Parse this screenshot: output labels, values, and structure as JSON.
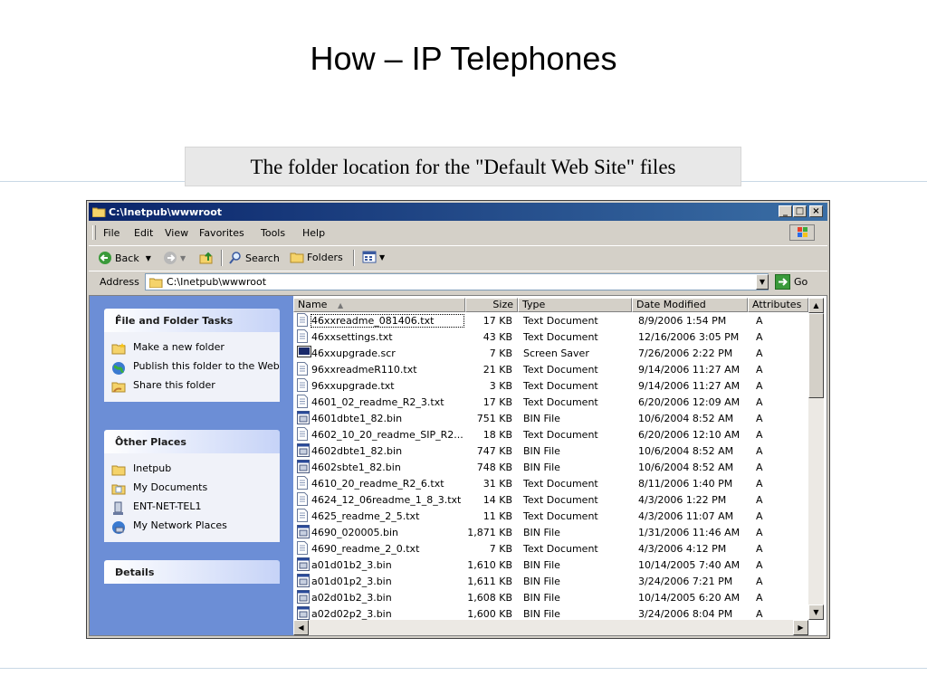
{
  "slide": {
    "title": "How – IP Telephones",
    "caption": "The folder location for the \"Default Web Site\" files"
  },
  "window": {
    "title": "C:\\Inetpub\\wwwroot",
    "menu": [
      "File",
      "Edit",
      "View",
      "Favorites",
      "Tools",
      "Help"
    ],
    "toolbar": {
      "back": "Back",
      "search": "Search",
      "folders": "Folders"
    },
    "address": {
      "label": "Address",
      "value": "C:\\Inetpub\\wwwroot",
      "go": "Go"
    }
  },
  "taskpane": {
    "file_tasks": {
      "title": "File and Folder Tasks",
      "items": [
        "Make a new folder",
        "Publish this folder to the Web",
        "Share this folder"
      ]
    },
    "other_places": {
      "title": "Other Places",
      "items": [
        "Inetpub",
        "My Documents",
        "ENT-NET-TEL1",
        "My Network Places"
      ]
    },
    "details": {
      "title": "Details"
    }
  },
  "columns": [
    "Name",
    "Size",
    "Type",
    "Date Modified",
    "Attributes"
  ],
  "files": [
    {
      "name": "46xxreadme_081406.txt",
      "size": "17 KB",
      "type": "Text Document",
      "date": "8/9/2006 1:54 PM",
      "attr": "A",
      "icon": "text-file-icon"
    },
    {
      "name": "46xxsettings.txt",
      "size": "43 KB",
      "type": "Text Document",
      "date": "12/16/2006 3:05 PM",
      "attr": "A",
      "icon": "text-file-icon"
    },
    {
      "name": "46xxupgrade.scr",
      "size": "7 KB",
      "type": "Screen Saver",
      "date": "7/26/2006 2:22 PM",
      "attr": "A",
      "icon": "screensaver-icon"
    },
    {
      "name": "96xxreadmeR110.txt",
      "size": "21 KB",
      "type": "Text Document",
      "date": "9/14/2006 11:27 AM",
      "attr": "A",
      "icon": "text-file-icon"
    },
    {
      "name": "96xxupgrade.txt",
      "size": "3 KB",
      "type": "Text Document",
      "date": "9/14/2006 11:27 AM",
      "attr": "A",
      "icon": "text-file-icon"
    },
    {
      "name": "4601_02_readme_R2_3.txt",
      "size": "17 KB",
      "type": "Text Document",
      "date": "6/20/2006 12:09 AM",
      "attr": "A",
      "icon": "text-file-icon"
    },
    {
      "name": "4601dbte1_82.bin",
      "size": "751 KB",
      "type": "BIN File",
      "date": "10/6/2004 8:52 AM",
      "attr": "A",
      "icon": "bin-file-icon"
    },
    {
      "name": "4602_10_20_readme_SIP_R2...",
      "size": "18 KB",
      "type": "Text Document",
      "date": "6/20/2006 12:10 AM",
      "attr": "A",
      "icon": "text-file-icon"
    },
    {
      "name": "4602dbte1_82.bin",
      "size": "747 KB",
      "type": "BIN File",
      "date": "10/6/2004 8:52 AM",
      "attr": "A",
      "icon": "bin-file-icon"
    },
    {
      "name": "4602sbte1_82.bin",
      "size": "748 KB",
      "type": "BIN File",
      "date": "10/6/2004 8:52 AM",
      "attr": "A",
      "icon": "bin-file-icon"
    },
    {
      "name": "4610_20_readme_R2_6.txt",
      "size": "31 KB",
      "type": "Text Document",
      "date": "8/11/2006 1:40 PM",
      "attr": "A",
      "icon": "text-file-icon"
    },
    {
      "name": "4624_12_06readme_1_8_3.txt",
      "size": "14 KB",
      "type": "Text Document",
      "date": "4/3/2006 1:22 PM",
      "attr": "A",
      "icon": "text-file-icon"
    },
    {
      "name": "4625_readme_2_5.txt",
      "size": "11 KB",
      "type": "Text Document",
      "date": "4/3/2006 11:07 AM",
      "attr": "A",
      "icon": "text-file-icon"
    },
    {
      "name": "4690_020005.bin",
      "size": "1,871 KB",
      "type": "BIN File",
      "date": "1/31/2006 11:46 AM",
      "attr": "A",
      "icon": "bin-file-icon"
    },
    {
      "name": "4690_readme_2_0.txt",
      "size": "7 KB",
      "type": "Text Document",
      "date": "4/3/2006 4:12 PM",
      "attr": "A",
      "icon": "text-file-icon"
    },
    {
      "name": "a01d01b2_3.bin",
      "size": "1,610 KB",
      "type": "BIN File",
      "date": "10/14/2005 7:40 AM",
      "attr": "A",
      "icon": "bin-file-icon"
    },
    {
      "name": "a01d01p2_3.bin",
      "size": "1,611 KB",
      "type": "BIN File",
      "date": "3/24/2006 7:21 PM",
      "attr": "A",
      "icon": "bin-file-icon"
    },
    {
      "name": "a02d01b2_3.bin",
      "size": "1,608 KB",
      "type": "BIN File",
      "date": "10/14/2005 6:20 AM",
      "attr": "A",
      "icon": "bin-file-icon"
    },
    {
      "name": "a02d02p2_3.bin",
      "size": "1,600 KB",
      "type": "BIN File",
      "date": "3/24/2006 8:04 PM",
      "attr": "A",
      "icon": "bin-file-icon"
    }
  ],
  "colors": {
    "titlebar_start": "#0a246a",
    "titlebar_end": "#3a6ea5",
    "taskpane_bg": "#6c8ed6",
    "chrome": "#d4d0c8"
  }
}
